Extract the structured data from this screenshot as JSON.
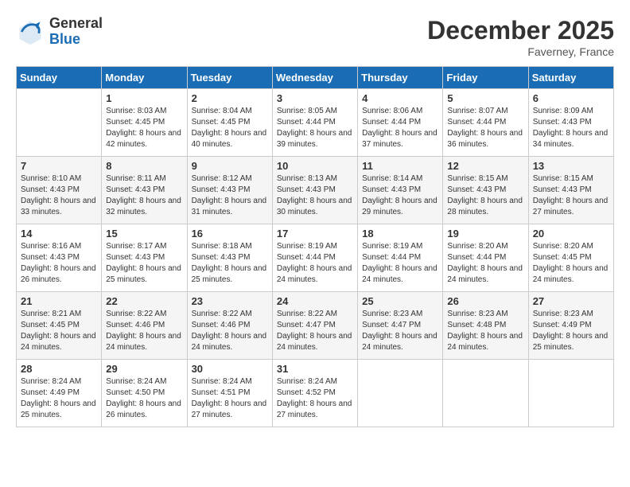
{
  "header": {
    "logo_general": "General",
    "logo_blue": "Blue",
    "month": "December 2025",
    "location": "Faverney, France"
  },
  "weekdays": [
    "Sunday",
    "Monday",
    "Tuesday",
    "Wednesday",
    "Thursday",
    "Friday",
    "Saturday"
  ],
  "weeks": [
    [
      {
        "day": "",
        "sunrise": "",
        "sunset": "",
        "daylight": ""
      },
      {
        "day": "1",
        "sunrise": "8:03 AM",
        "sunset": "4:45 PM",
        "daylight": "8 hours and 42 minutes."
      },
      {
        "day": "2",
        "sunrise": "8:04 AM",
        "sunset": "4:45 PM",
        "daylight": "8 hours and 40 minutes."
      },
      {
        "day": "3",
        "sunrise": "8:05 AM",
        "sunset": "4:44 PM",
        "daylight": "8 hours and 39 minutes."
      },
      {
        "day": "4",
        "sunrise": "8:06 AM",
        "sunset": "4:44 PM",
        "daylight": "8 hours and 37 minutes."
      },
      {
        "day": "5",
        "sunrise": "8:07 AM",
        "sunset": "4:44 PM",
        "daylight": "8 hours and 36 minutes."
      },
      {
        "day": "6",
        "sunrise": "8:09 AM",
        "sunset": "4:43 PM",
        "daylight": "8 hours and 34 minutes."
      }
    ],
    [
      {
        "day": "7",
        "sunrise": "8:10 AM",
        "sunset": "4:43 PM",
        "daylight": "8 hours and 33 minutes."
      },
      {
        "day": "8",
        "sunrise": "8:11 AM",
        "sunset": "4:43 PM",
        "daylight": "8 hours and 32 minutes."
      },
      {
        "day": "9",
        "sunrise": "8:12 AM",
        "sunset": "4:43 PM",
        "daylight": "8 hours and 31 minutes."
      },
      {
        "day": "10",
        "sunrise": "8:13 AM",
        "sunset": "4:43 PM",
        "daylight": "8 hours and 30 minutes."
      },
      {
        "day": "11",
        "sunrise": "8:14 AM",
        "sunset": "4:43 PM",
        "daylight": "8 hours and 29 minutes."
      },
      {
        "day": "12",
        "sunrise": "8:15 AM",
        "sunset": "4:43 PM",
        "daylight": "8 hours and 28 minutes."
      },
      {
        "day": "13",
        "sunrise": "8:15 AM",
        "sunset": "4:43 PM",
        "daylight": "8 hours and 27 minutes."
      }
    ],
    [
      {
        "day": "14",
        "sunrise": "8:16 AM",
        "sunset": "4:43 PM",
        "daylight": "8 hours and 26 minutes."
      },
      {
        "day": "15",
        "sunrise": "8:17 AM",
        "sunset": "4:43 PM",
        "daylight": "8 hours and 25 minutes."
      },
      {
        "day": "16",
        "sunrise": "8:18 AM",
        "sunset": "4:43 PM",
        "daylight": "8 hours and 25 minutes."
      },
      {
        "day": "17",
        "sunrise": "8:19 AM",
        "sunset": "4:44 PM",
        "daylight": "8 hours and 24 minutes."
      },
      {
        "day": "18",
        "sunrise": "8:19 AM",
        "sunset": "4:44 PM",
        "daylight": "8 hours and 24 minutes."
      },
      {
        "day": "19",
        "sunrise": "8:20 AM",
        "sunset": "4:44 PM",
        "daylight": "8 hours and 24 minutes."
      },
      {
        "day": "20",
        "sunrise": "8:20 AM",
        "sunset": "4:45 PM",
        "daylight": "8 hours and 24 minutes."
      }
    ],
    [
      {
        "day": "21",
        "sunrise": "8:21 AM",
        "sunset": "4:45 PM",
        "daylight": "8 hours and 24 minutes."
      },
      {
        "day": "22",
        "sunrise": "8:22 AM",
        "sunset": "4:46 PM",
        "daylight": "8 hours and 24 minutes."
      },
      {
        "day": "23",
        "sunrise": "8:22 AM",
        "sunset": "4:46 PM",
        "daylight": "8 hours and 24 minutes."
      },
      {
        "day": "24",
        "sunrise": "8:22 AM",
        "sunset": "4:47 PM",
        "daylight": "8 hours and 24 minutes."
      },
      {
        "day": "25",
        "sunrise": "8:23 AM",
        "sunset": "4:47 PM",
        "daylight": "8 hours and 24 minutes."
      },
      {
        "day": "26",
        "sunrise": "8:23 AM",
        "sunset": "4:48 PM",
        "daylight": "8 hours and 24 minutes."
      },
      {
        "day": "27",
        "sunrise": "8:23 AM",
        "sunset": "4:49 PM",
        "daylight": "8 hours and 25 minutes."
      }
    ],
    [
      {
        "day": "28",
        "sunrise": "8:24 AM",
        "sunset": "4:49 PM",
        "daylight": "8 hours and 25 minutes."
      },
      {
        "day": "29",
        "sunrise": "8:24 AM",
        "sunset": "4:50 PM",
        "daylight": "8 hours and 26 minutes."
      },
      {
        "day": "30",
        "sunrise": "8:24 AM",
        "sunset": "4:51 PM",
        "daylight": "8 hours and 27 minutes."
      },
      {
        "day": "31",
        "sunrise": "8:24 AM",
        "sunset": "4:52 PM",
        "daylight": "8 hours and 27 minutes."
      },
      {
        "day": "",
        "sunrise": "",
        "sunset": "",
        "daylight": ""
      },
      {
        "day": "",
        "sunrise": "",
        "sunset": "",
        "daylight": ""
      },
      {
        "day": "",
        "sunrise": "",
        "sunset": "",
        "daylight": ""
      }
    ]
  ],
  "labels": {
    "sunrise_prefix": "Sunrise: ",
    "sunset_prefix": "Sunset: ",
    "daylight_prefix": "Daylight: "
  }
}
